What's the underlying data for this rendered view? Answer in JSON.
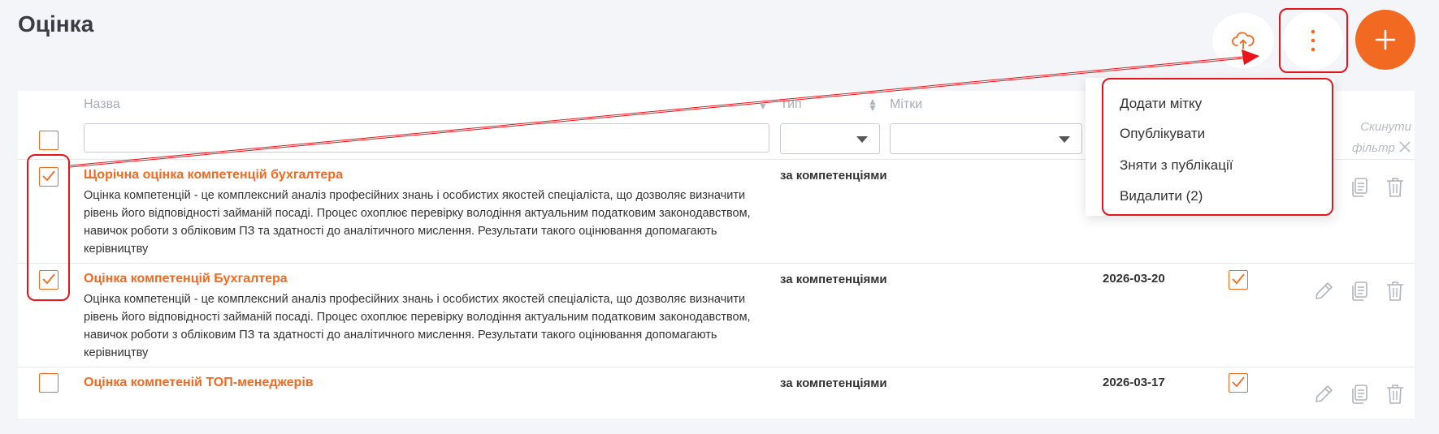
{
  "page": {
    "title": "Оцінка"
  },
  "toolbar": {
    "upload_icon": "cloud-upload-icon",
    "more_icon": "more-vertical-icon",
    "add_icon": "plus-icon",
    "accent": "#f26a21"
  },
  "table": {
    "columns": {
      "name": "Назва",
      "type": "Тип",
      "tags": "Мітки"
    },
    "reset_filter": {
      "line1": "Скинути",
      "line2": "фільтр"
    },
    "rows": [
      {
        "checked": true,
        "title": "Щорічна оцінка компетенцій бухгалтера",
        "description": "Оцінка компетенцій - це комплексний аналіз професійних знань і особистих якостей спеціаліста, що дозволяє визначити рівень його відповідності займаній посаді. Процес охоплює перевірку володіння актуальним податковим законодавством, навичок роботи з обліковим ПЗ та здатності до аналітичного мислення. Результати такого оцінювання допомагають керівництву",
        "type": "за компетенціями",
        "date": "",
        "published": false
      },
      {
        "checked": true,
        "title": "Оцінка компетенцій Бухгалтера",
        "description": "Оцінка компетенцій - це комплексний аналіз професійних знань і особистих якостей спеціаліста, що дозволяє визначити рівень його відповідності займаній посаді. Процес охоплює перевірку володіння актуальним податковим законодавством, навичок роботи з обліковим ПЗ та здатності до аналітичного мислення. Результати такого оцінювання допомагають керівництву",
        "type": "за компетенціями",
        "date": "2026-03-20",
        "published": true
      },
      {
        "checked": false,
        "title": "Оцінка компетеній ТОП-менеджерів",
        "description": "",
        "type": "за компетенціями",
        "date": "2026-03-17",
        "published": true
      }
    ]
  },
  "menu": {
    "items": [
      "Додати мітку",
      "Опублікувати",
      "Зняти з публікації",
      "Видалити (2)"
    ]
  },
  "annotation_color": "#e8141a"
}
